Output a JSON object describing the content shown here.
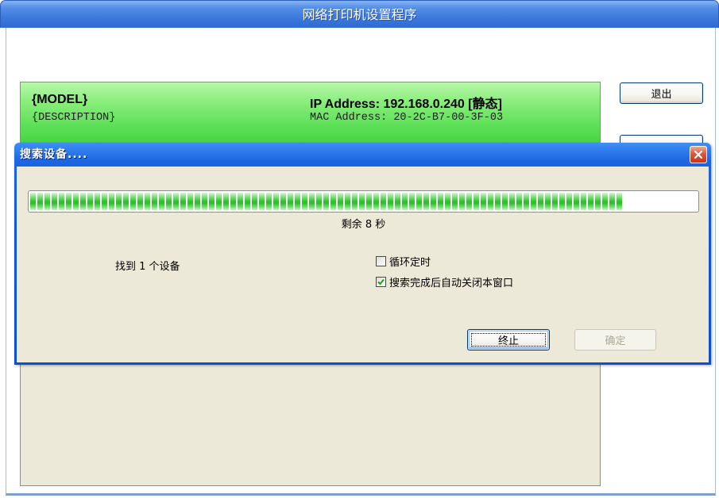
{
  "window": {
    "title": "网络打印机设置程序"
  },
  "device_list": {
    "items": [
      {
        "model": "{MODEL}",
        "description": "{DESCRIPTION}",
        "ip": "IP Address: 192.168.0.240 [静态]",
        "mac": "MAC Address: 20-2C-B7-00-3F-03",
        "selected": true
      }
    ]
  },
  "side_buttons": {
    "exit_label": "退出"
  },
  "dialog": {
    "title": "搜索设备....",
    "progress": 0.89,
    "remaining_text": "剩余 8 秒",
    "found_text": "找到 1 个设备",
    "options": [
      {
        "label": "循环定时",
        "checked": false
      },
      {
        "label": "搜索完成后自动关闭本窗口",
        "checked": true
      }
    ],
    "stop_label": "终止",
    "ok_label": "确定",
    "ok_disabled": true
  },
  "icons": {
    "close": "close-icon",
    "checkmark": "checkmark-icon"
  },
  "colors": {
    "title_bar": "#3a78dc",
    "selected_row": "#5ee058",
    "dialog_face": "#ece9d8",
    "progress_fill": "#2ec12b",
    "close_button": "#e0553a",
    "dialog_title": "#0f56d6"
  }
}
